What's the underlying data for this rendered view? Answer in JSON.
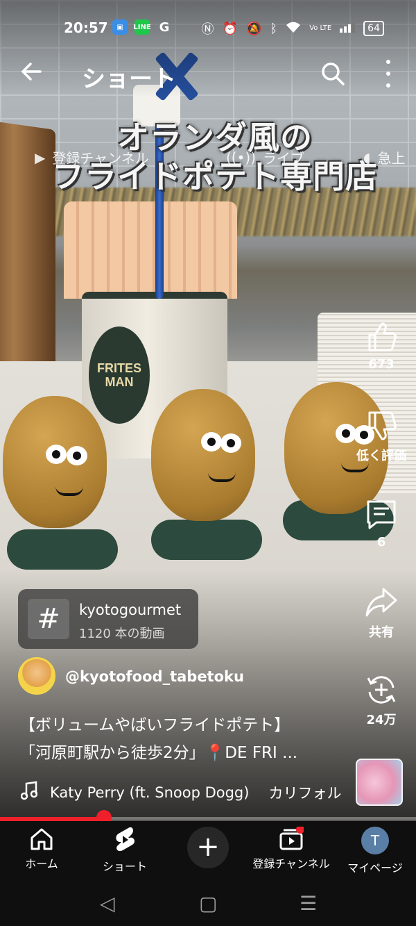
{
  "status_bar": {
    "time": "20:57",
    "app_icons": [
      "image-app-icon",
      "LINE",
      "G"
    ],
    "battery": "64",
    "signal_label": "Vo LTE"
  },
  "header": {
    "title": "ショート",
    "back_icon": "back-arrow-icon",
    "search_icon": "search-icon",
    "more_icon": "more-vert-icon"
  },
  "chips": {
    "subscriptions": "登録チャンネル",
    "live": "ライブ",
    "trending": "急上"
  },
  "video": {
    "caption_line1": "オランダ風の",
    "caption_line2": "フライドポテト専門店",
    "cup_logo": "FRITES MAN"
  },
  "actions": {
    "like_count": "673",
    "dislike_label": "低く評価",
    "comment_count": "6",
    "share_label": "共有",
    "remix_count": "24万"
  },
  "hashtag": {
    "name": "kyotogourmet",
    "count": "1120 本の動画"
  },
  "channel": {
    "handle": "@kyotofood_tabetoku"
  },
  "description": {
    "line1": "【ボリュームやばいフライドポテト】",
    "line2": "「河原町駅から徒歩2分」📍DE FRI ..."
  },
  "music": {
    "track": "Katy Perry (ft. Snoop Dogg)",
    "title_fragment": "カリフォル"
  },
  "progress": {
    "fraction": 0.25
  },
  "bottom_nav": {
    "home": "ホーム",
    "shorts": "ショート",
    "subscriptions": "登録チャンネル",
    "mypage": "マイページ",
    "avatar_letter": "T"
  },
  "colors": {
    "accent": "#f0202a",
    "nav_bg": "#0f0f0f"
  }
}
